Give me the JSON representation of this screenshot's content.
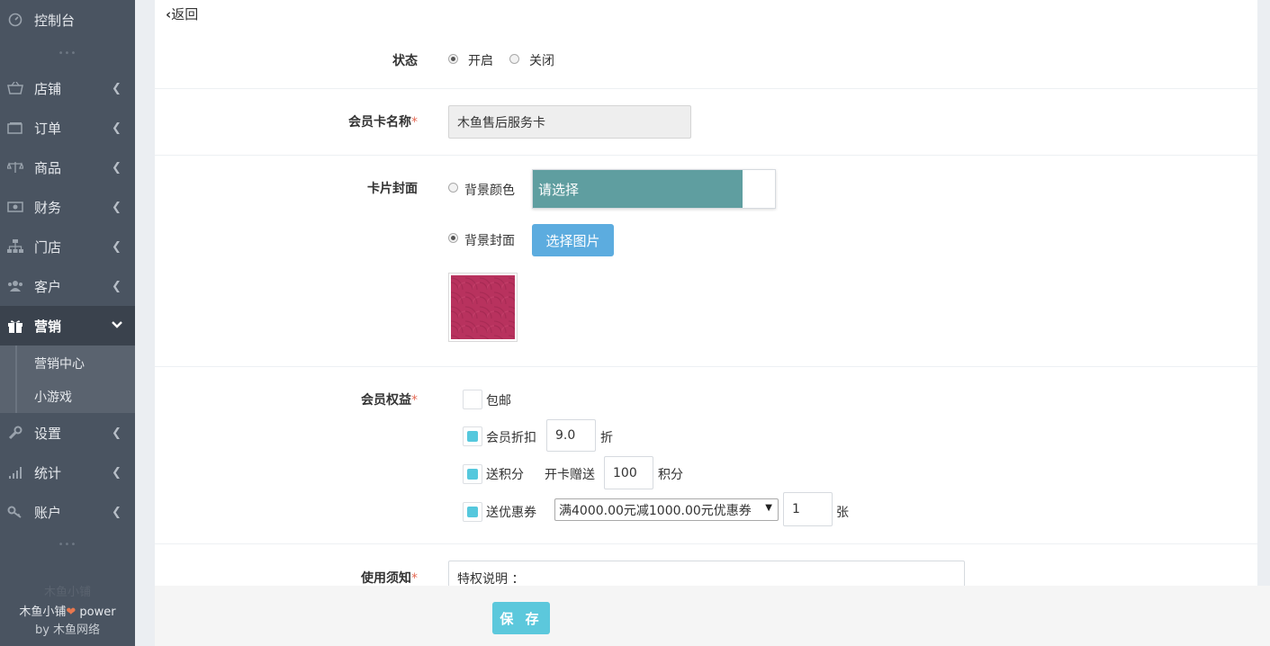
{
  "sidebar": {
    "items": [
      {
        "label": "控制台",
        "icon": "dashboard-icon"
      },
      {
        "label": "店铺",
        "icon": "shop-basket-icon"
      },
      {
        "label": "订单",
        "icon": "order-icon"
      },
      {
        "label": "商品",
        "icon": "scale-icon"
      },
      {
        "label": "财务",
        "icon": "money-icon"
      },
      {
        "label": "门店",
        "icon": "sitemap-icon"
      },
      {
        "label": "客户",
        "icon": "users-icon"
      },
      {
        "label": "营销",
        "icon": "gift-icon"
      },
      {
        "label": "设置",
        "icon": "wrench-icon"
      },
      {
        "label": "统计",
        "icon": "signal-icon"
      },
      {
        "label": "账户",
        "icon": "key-icon"
      }
    ],
    "submenu": [
      "营销中心",
      "小游戏"
    ],
    "footer": {
      "ghost": "木鱼小铺",
      "brand": "木鱼小铺",
      "power": " power",
      "by": "by 木鱼网络"
    }
  },
  "main": {
    "back_label": "返回",
    "status": {
      "label": "状态",
      "on": "开启",
      "off": "关闭"
    },
    "card_name": {
      "label": "会员卡名称",
      "star": "*",
      "value": "木鱼售后服务卡"
    },
    "cover": {
      "label": "卡片封面",
      "bg_color_label": "背景颜色",
      "color_picker_text": "请选择",
      "bg_cover_label": "背景封面",
      "select_image_button": "选择图片"
    },
    "benefits": {
      "label": "会员权益",
      "star": "*",
      "free_shipping": "包邮",
      "discount_label": "会员折扣",
      "discount_value": "9.0",
      "discount_unit": "折",
      "points_label": "送积分",
      "points_prefix": "开卡赠送",
      "points_value": "100",
      "points_unit": "积分",
      "coupon_label": "送优惠券",
      "coupon_selected": "满4000.00元减1000.00元优惠券",
      "coupon_qty": "1",
      "coupon_unit": "张"
    },
    "notice": {
      "label": "使用须知",
      "star": "*",
      "value": "特权说明 ："
    },
    "save_button": "保 存"
  }
}
